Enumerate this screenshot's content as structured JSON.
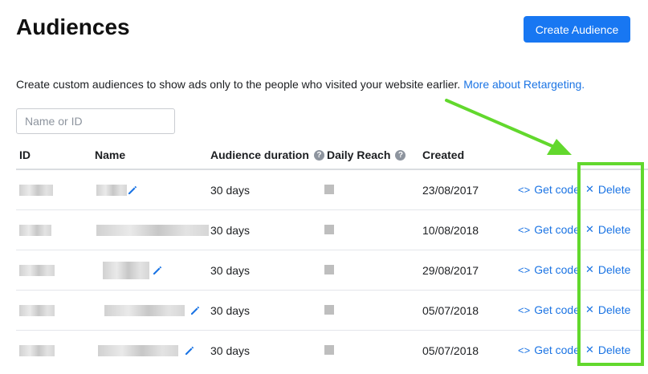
{
  "page": {
    "title": "Audiences",
    "create_button": "Create Audience",
    "intro_text": "Create custom audiences to show ads only to the people who visited your website earlier.",
    "intro_link": "More about Retargeting.",
    "search_placeholder": "Name or ID"
  },
  "table": {
    "columns": {
      "id": "ID",
      "name": "Name",
      "duration": "Audience duration",
      "reach": "Daily Reach",
      "created": "Created"
    },
    "actions": {
      "get_code": "Get code",
      "delete": "Delete"
    },
    "rows": [
      {
        "duration": "30 days",
        "created": "23/08/2017"
      },
      {
        "duration": "30 days",
        "created": "10/08/2018"
      },
      {
        "duration": "30 days",
        "created": "29/08/2017"
      },
      {
        "duration": "30 days",
        "created": "05/07/2018"
      },
      {
        "duration": "30 days",
        "created": "05/07/2018"
      }
    ]
  },
  "icons": {
    "help": "question-circle-icon",
    "edit": "pencil-icon",
    "code": "code-brackets-icon",
    "delete": "close-x-icon"
  },
  "colors": {
    "primary": "#1877f2",
    "link": "#1b74e4",
    "highlight": "#62d82d"
  }
}
